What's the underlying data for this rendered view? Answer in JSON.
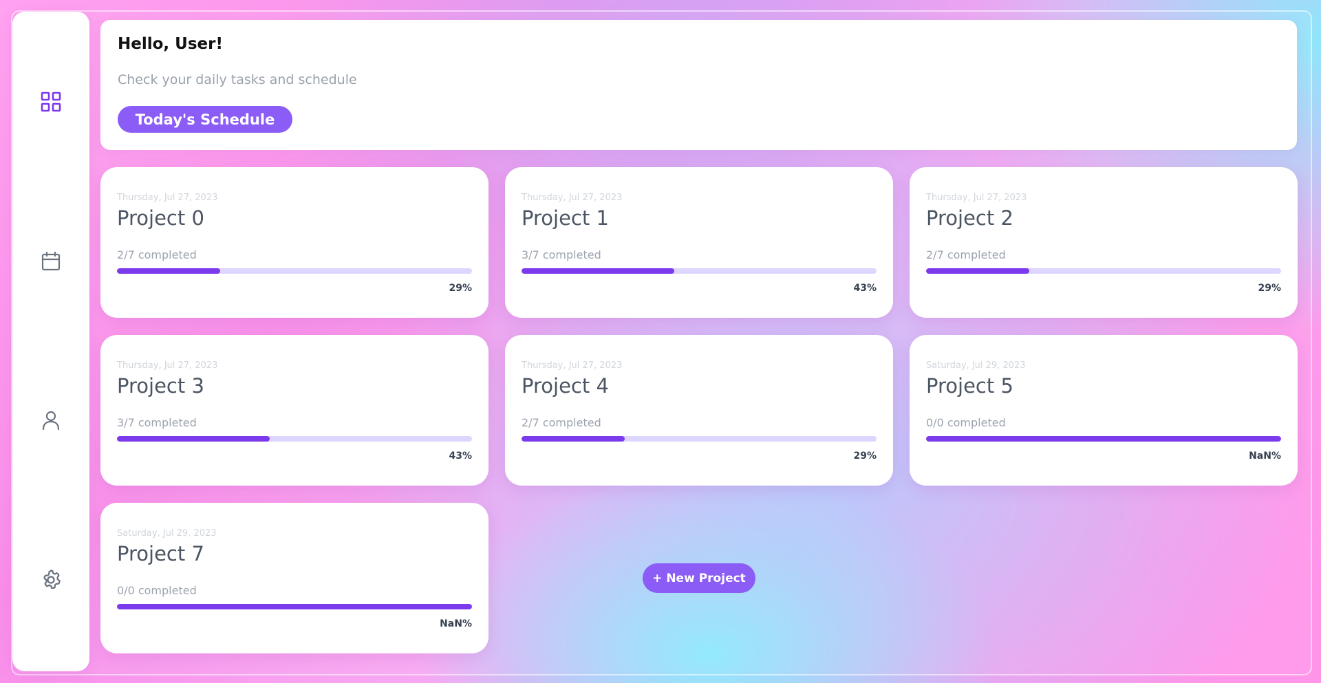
{
  "colors": {
    "accent": "#8b5cf6",
    "progress_fill": "#7c3aed",
    "progress_track": "#ddd6fe",
    "icon_active": "#7c3aed",
    "icon_inactive": "#6b7280"
  },
  "sidebar": {
    "items": [
      {
        "icon": "grid-icon",
        "active": true
      },
      {
        "icon": "calendar-icon",
        "active": false
      },
      {
        "icon": "user-icon",
        "active": false
      },
      {
        "icon": "gear-icon",
        "active": false
      }
    ]
  },
  "header": {
    "greeting": "Hello, User!",
    "subtitle": "Check your daily tasks and schedule",
    "schedule_button": "Today's Schedule"
  },
  "projects": [
    {
      "date": "Thursday, Jul 27, 2023",
      "title": "Project 0",
      "completed": "2/7 completed",
      "progress": 0.29,
      "percent_label": "29%"
    },
    {
      "date": "Thursday, Jul 27, 2023",
      "title": "Project 1",
      "completed": "3/7 completed",
      "progress": 0.43,
      "percent_label": "43%"
    },
    {
      "date": "Thursday, Jul 27, 2023",
      "title": "Project 2",
      "completed": "2/7 completed",
      "progress": 0.29,
      "percent_label": "29%"
    },
    {
      "date": "Thursday, Jul 27, 2023",
      "title": "Project 3",
      "completed": "3/7 completed",
      "progress": 0.43,
      "percent_label": "43%"
    },
    {
      "date": "Thursday, Jul 27, 2023",
      "title": "Project 4",
      "completed": "2/7 completed",
      "progress": 0.29,
      "percent_label": "29%"
    },
    {
      "date": "Saturday, Jul 29, 2023",
      "title": "Project 5",
      "completed": "0/0 completed",
      "progress": 1.0,
      "percent_label": "NaN%"
    },
    {
      "date": "Saturday, Jul 29, 2023",
      "title": "Project 7",
      "completed": "0/0 completed",
      "progress": 1.0,
      "percent_label": "NaN%"
    }
  ],
  "new_project_button": "+ New Project"
}
